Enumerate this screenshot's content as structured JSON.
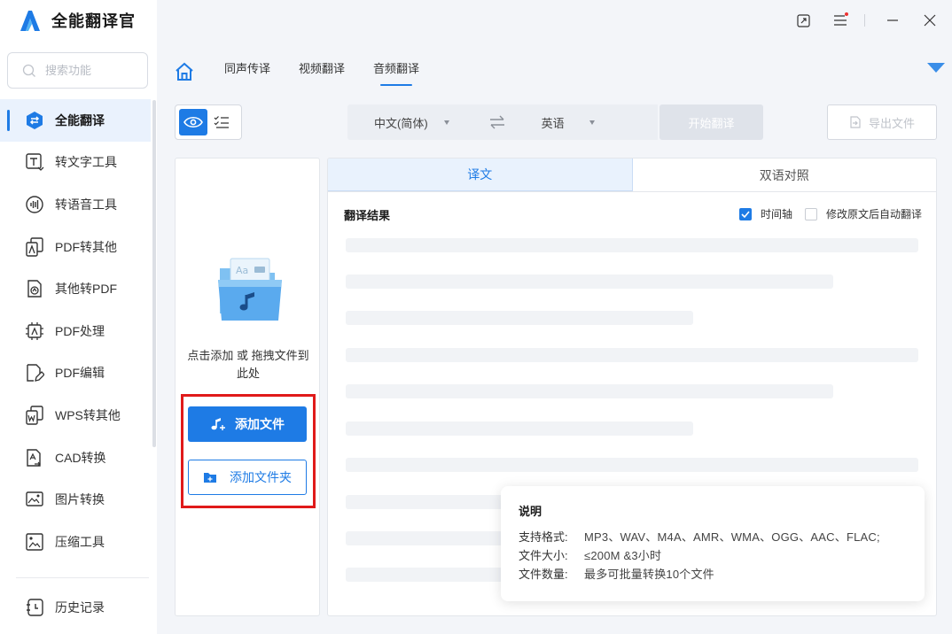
{
  "app": {
    "title": "全能翻译官"
  },
  "search": {
    "placeholder": "搜索功能"
  },
  "sidebar": {
    "items": [
      {
        "label": "全能翻译",
        "icon": "translate-icon",
        "active": true
      },
      {
        "label": "转文字工具",
        "icon": "text-convert-icon"
      },
      {
        "label": "转语音工具",
        "icon": "voice-icon"
      },
      {
        "label": "PDF转其他",
        "icon": "pdf-export-icon"
      },
      {
        "label": "其他转PDF",
        "icon": "to-pdf-icon"
      },
      {
        "label": "PDF处理",
        "icon": "pdf-process-icon"
      },
      {
        "label": "PDF编辑",
        "icon": "pdf-edit-icon"
      },
      {
        "label": "WPS转其他",
        "icon": "wps-icon"
      },
      {
        "label": "CAD转换",
        "icon": "cad-icon"
      },
      {
        "label": "图片转换",
        "icon": "image-convert-icon"
      },
      {
        "label": "压缩工具",
        "icon": "compress-icon"
      }
    ],
    "history": "历史记录"
  },
  "tabs": {
    "items": [
      "同声传译",
      "视频翻译",
      "音频翻译"
    ],
    "active_index": 2
  },
  "toolbar": {
    "source_lang": "中文(简体)",
    "target_lang": "英语",
    "start_label": "开始翻译",
    "export_label": "导出文件"
  },
  "upload": {
    "hint": "点击添加 或 拖拽文件到此处",
    "add_file": "添加文件",
    "add_folder": "添加文件夹"
  },
  "result": {
    "tabs": [
      "译文",
      "双语对照"
    ],
    "title": "翻译结果",
    "opt_timeline": "时间轴",
    "opt_timeline_checked": true,
    "opt_autotranslate": "修改原文后自动翻译",
    "opt_autotranslate_checked": false
  },
  "info": {
    "title": "说明",
    "rows": [
      {
        "k": "支持格式:",
        "v": "MP3、WAV、M4A、AMR、WMA、OGG、AAC、FLAC;"
      },
      {
        "k": "文件大小:",
        "v": "≤200M &3小时"
      },
      {
        "k": "文件数量:",
        "v": "最多可批量转换10个文件"
      }
    ]
  },
  "colors": {
    "accent": "#1e7be5",
    "highlight_box": "#e01a1a"
  }
}
